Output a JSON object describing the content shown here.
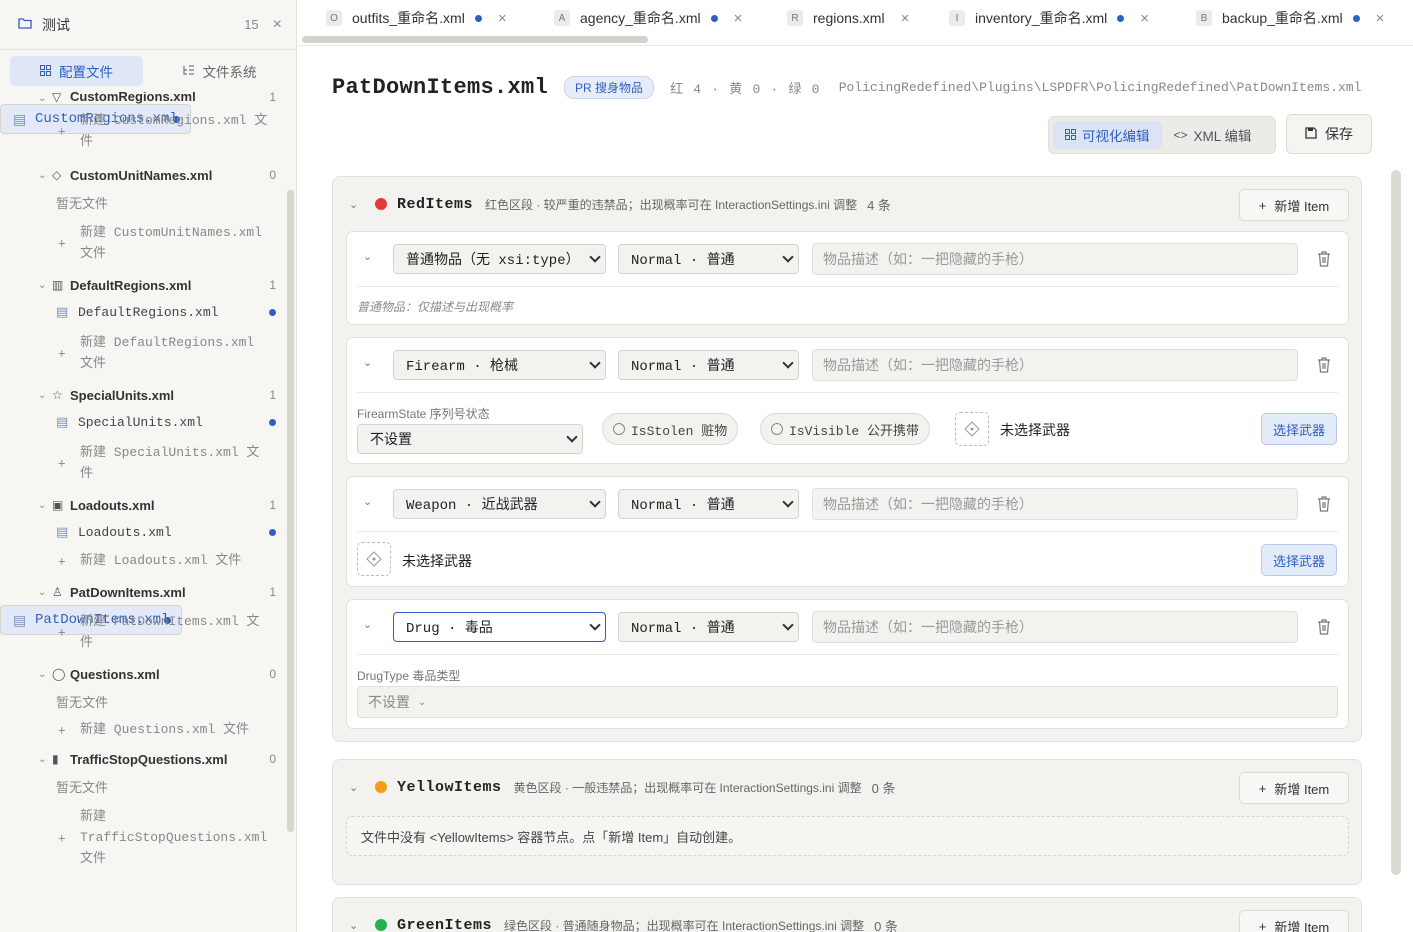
{
  "sidebar": {
    "title": "测试",
    "count": "15",
    "close": "×",
    "tabs": [
      {
        "label": "配置文件"
      },
      {
        "label": "文件系统"
      }
    ],
    "groups": [
      {
        "name": "CustomRegions.xml",
        "count": "1",
        "file": "CustomRegions.xml",
        "new_label": "新建 CustomRegions.xml 文件"
      },
      {
        "name": "CustomUnitNames.xml",
        "count": "0",
        "empty": "暂无文件",
        "new_label": "新建 CustomUnitNames.xml 文件"
      },
      {
        "name": "DefaultRegions.xml",
        "count": "1",
        "file": "DefaultRegions.xml",
        "new_label": "新建 DefaultRegions.xml 文件"
      },
      {
        "name": "SpecialUnits.xml",
        "count": "1",
        "file": "SpecialUnits.xml",
        "new_label": "新建 SpecialUnits.xml 文件"
      },
      {
        "name": "Loadouts.xml",
        "count": "1",
        "file": "Loadouts.xml",
        "new_label": "新建 Loadouts.xml 文件"
      },
      {
        "name": "PatDownItems.xml",
        "count": "1",
        "file": "PatDownItems.xml",
        "new_label": "新建 PatDownItems.xml 文件"
      },
      {
        "name": "Questions.xml",
        "count": "0",
        "empty": "暂无文件",
        "new_label": "新建 Questions.xml 文件"
      },
      {
        "name": "TrafficStopQuestions.xml",
        "count": "0",
        "empty": "暂无文件",
        "new_label_a": "新建",
        "new_label_b": "TrafficStopQuestions.xml",
        "new_label_c": "文件"
      }
    ]
  },
  "tabs": [
    {
      "badge": "O",
      "label": "outfits_重命名.xml",
      "modified": true
    },
    {
      "badge": "A",
      "label": "agency_重命名.xml",
      "modified": true
    },
    {
      "badge": "R",
      "label": "regions.xml",
      "modified": false
    },
    {
      "badge": "I",
      "label": "inventory_重命名.xml",
      "modified": true
    },
    {
      "badge": "B",
      "label": "backup_重命名.xml",
      "modified": true
    }
  ],
  "header": {
    "title": "PatDownItems.xml",
    "badge": "PR 搜身物品",
    "stats": "红 4 · 黄 0 · 绿 0",
    "path": "PolicingRedefined\\Plugins\\LSPDFR\\PolicingRedefined\\PatDownItems.xml",
    "mode_visual": "可视化编辑",
    "mode_xml": "XML 编辑",
    "save": "保存"
  },
  "sections": {
    "red": {
      "name": "RedItems",
      "desc": "红色区段 · 较严重的违禁品；出现概率可在 InteractionSettings.ini 调整",
      "count": "4 条",
      "add": "新增 Item",
      "color": "#e5393f"
    },
    "yellow": {
      "name": "YellowItems",
      "desc": "黄色区段 · 一般违禁品；出现概率可在 InteractionSettings.ini 调整",
      "count": "0 条",
      "add": "新增 Item",
      "empty": "文件中没有 <YellowItems> 容器节点。点「新增 Item」自动创建。",
      "color": "#f39c1a"
    },
    "green": {
      "name": "GreenItems",
      "desc": "绿色区段 · 普通随身物品；出现概率可在 InteractionSettings.ini 调整",
      "count": "0 条",
      "add": "新增 Item",
      "color": "#26b050"
    }
  },
  "items": [
    {
      "type": "普通物品（无 xsi:type）",
      "level": "Normal · 普通",
      "desc_placeholder": "物品描述（如：一把隐藏的手枪）",
      "hint": "普通物品：仅描述与出现概率"
    },
    {
      "type": "Firearm · 枪械",
      "level": "Normal · 普通",
      "desc_placeholder": "物品描述（如：一把隐藏的手枪）",
      "state_label": "FirearmState 序列号状态",
      "state_value": "不设置",
      "stolen": "IsStolen 赃物",
      "visible": "IsVisible 公开携带",
      "weapon": "未选择武器",
      "pick": "选择武器"
    },
    {
      "type": "Weapon · 近战武器",
      "level": "Normal · 普通",
      "desc_placeholder": "物品描述（如：一把隐藏的手枪）",
      "weapon": "未选择武器",
      "pick": "选择武器"
    },
    {
      "type": "Drug · 毒品",
      "level": "Normal · 普通",
      "desc_placeholder": "物品描述（如：一把隐藏的手枪）",
      "drug_label": "DrugType 毒品类型",
      "drug_value": "不设置"
    }
  ]
}
